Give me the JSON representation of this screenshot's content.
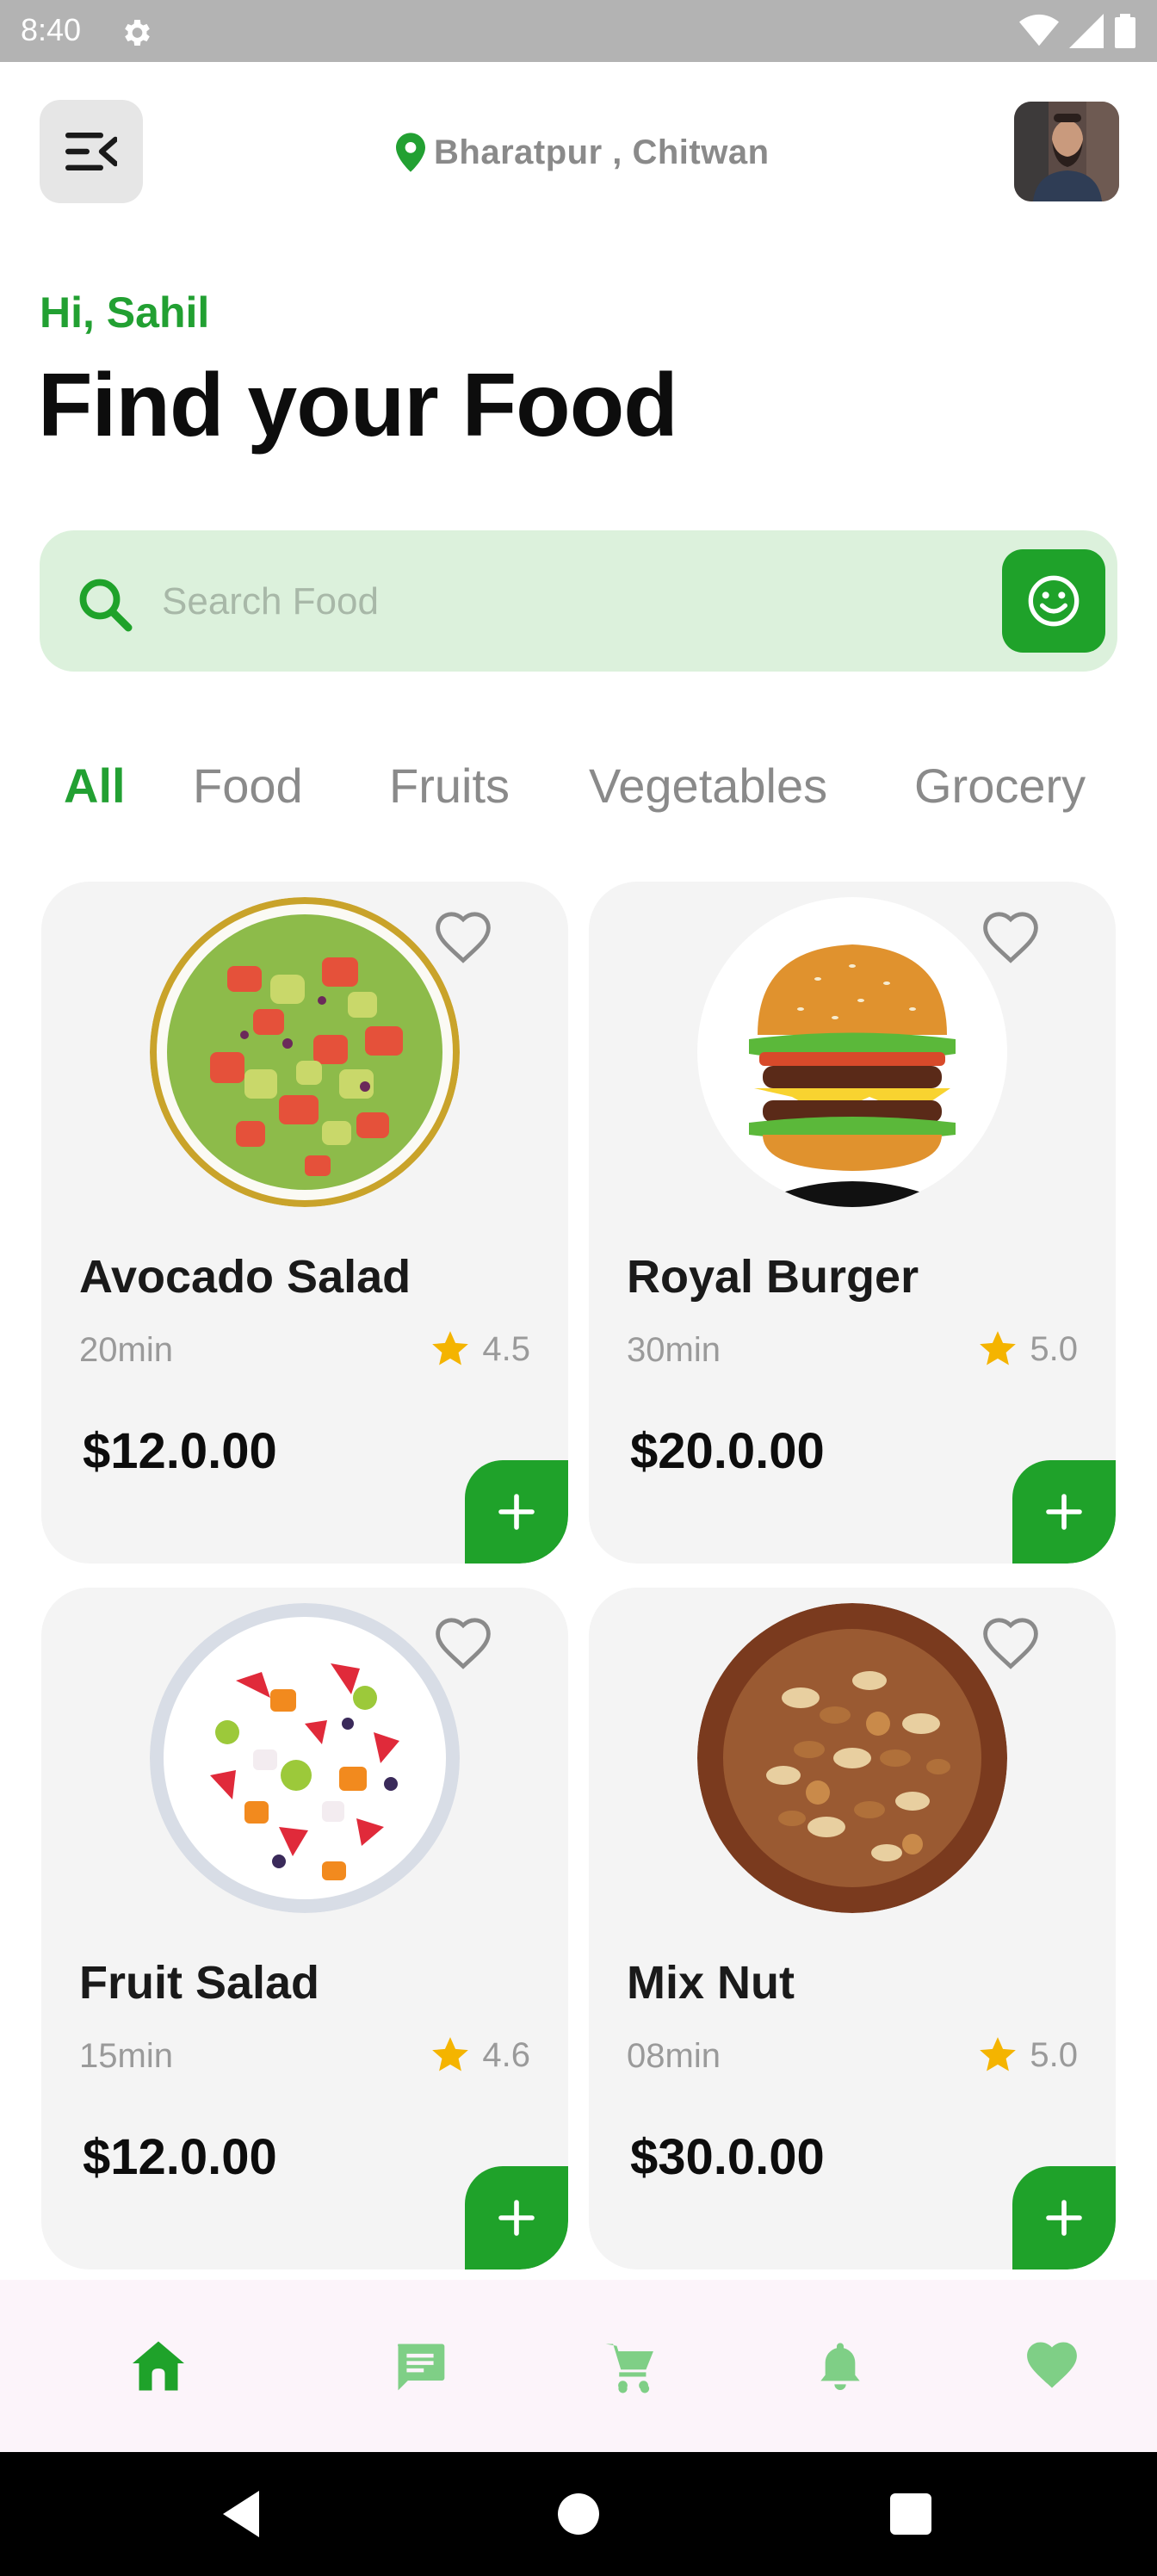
{
  "status_bar": {
    "time": "8:40"
  },
  "header": {
    "location": "Bharatpur , Chitwan"
  },
  "greeting": "Hi, Sahil",
  "page_title": "Find your Food",
  "search": {
    "placeholder": "Search Food",
    "value": ""
  },
  "categories": [
    {
      "label": "All",
      "active": true
    },
    {
      "label": "Food",
      "active": false
    },
    {
      "label": "Fruits",
      "active": false
    },
    {
      "label": "Vegetables",
      "active": false
    },
    {
      "label": "Grocery",
      "active": false
    }
  ],
  "products": [
    {
      "name": "Avocado Salad",
      "time": "20min",
      "rating": "4.5",
      "price": "$12.0.00"
    },
    {
      "name": "Royal Burger",
      "time": "30min",
      "rating": "5.0",
      "price": "$20.0.00"
    },
    {
      "name": "Fruit Salad",
      "time": "15min",
      "rating": "4.6",
      "price": "$12.0.00"
    },
    {
      "name": "Mix Nut",
      "time": "08min",
      "rating": "5.0",
      "price": "$30.0.00"
    }
  ],
  "bottom_nav": [
    {
      "icon": "home-icon",
      "active": true
    },
    {
      "icon": "chat-icon",
      "active": false
    },
    {
      "icon": "cart-icon",
      "active": false
    },
    {
      "icon": "bell-icon",
      "active": false
    },
    {
      "icon": "heart-icon",
      "active": false
    }
  ],
  "colors": {
    "accent": "#1fa22a",
    "accent_light": "#dcf1dc",
    "nav_inactive": "#7fcf86",
    "star": "#f4b400",
    "card_bg": "#f4f4f4",
    "nav_bg": "#fcf4fa"
  }
}
